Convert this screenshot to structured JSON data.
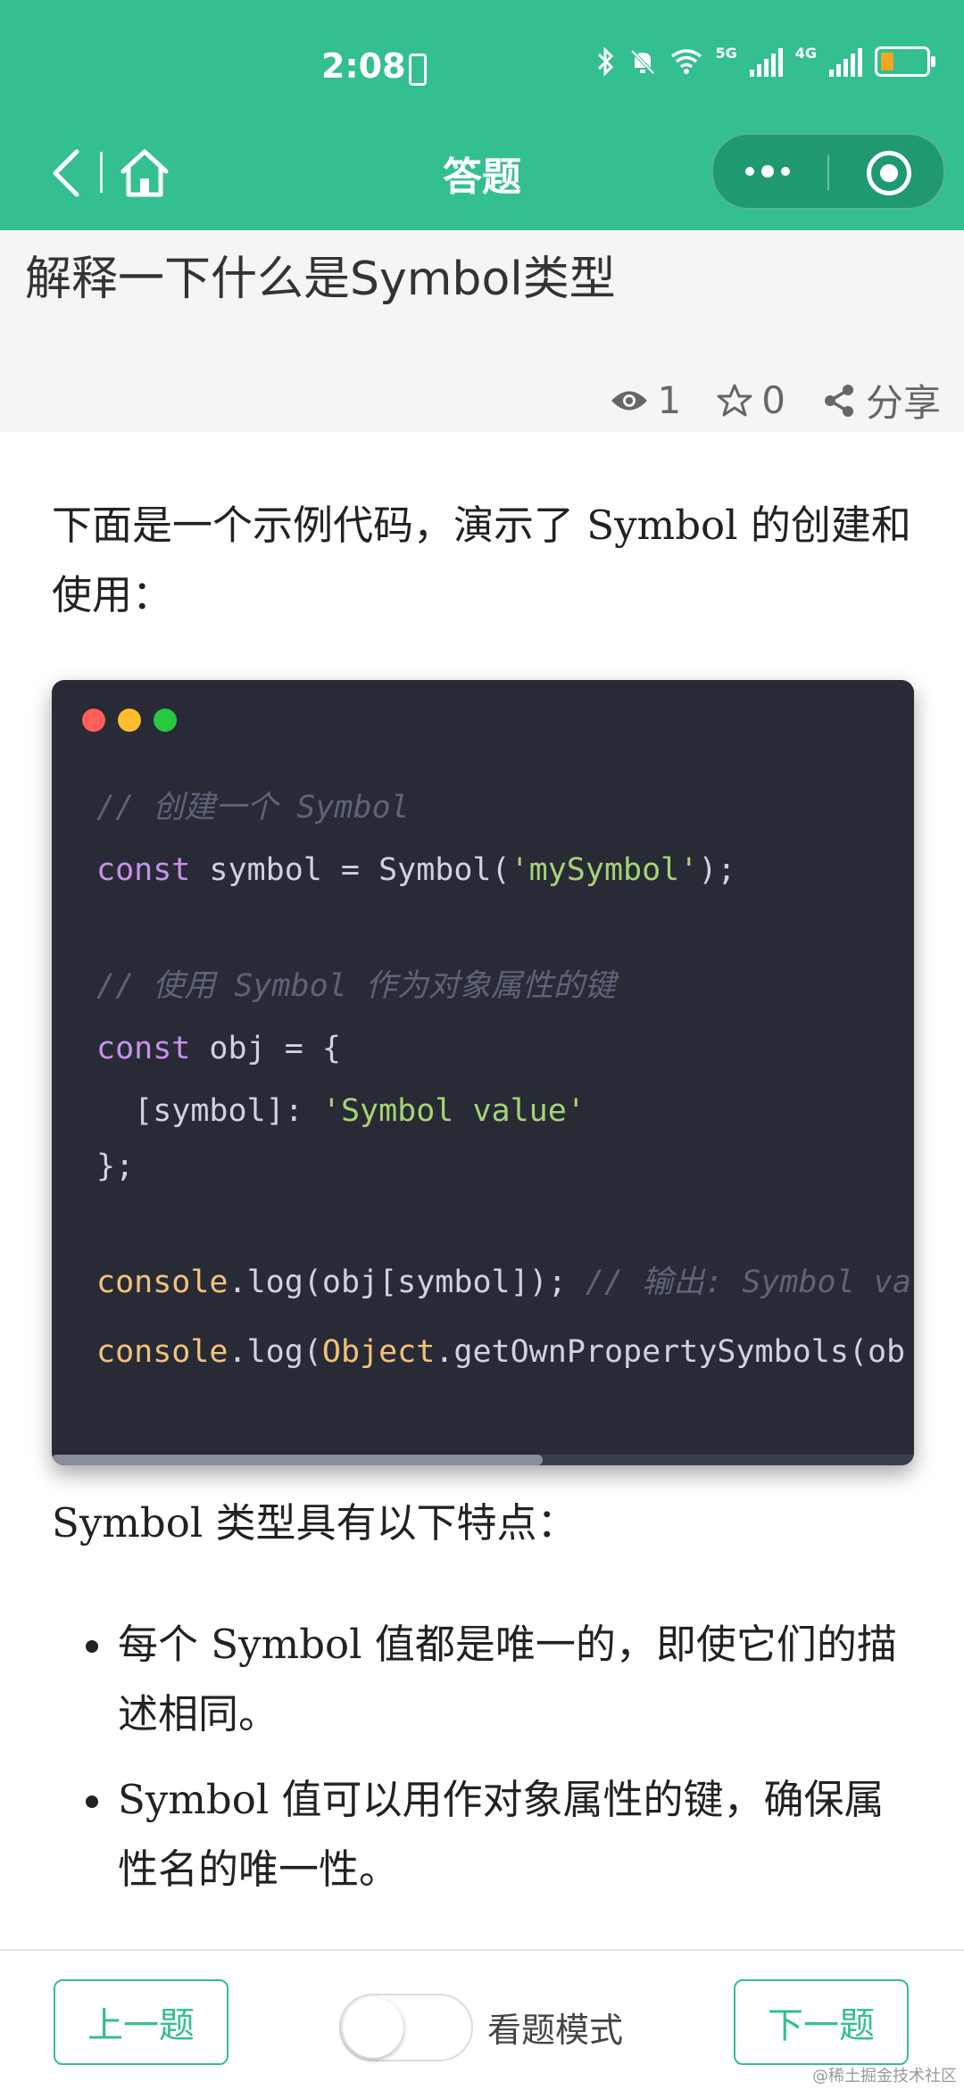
{
  "status_bar": {
    "time": "2:08",
    "net_small": "5G",
    "net_4g": "4G"
  },
  "nav": {
    "title": "答题"
  },
  "question": {
    "title": "解释一下什么是Symbol类型",
    "views": "1",
    "stars": "0",
    "share_label": "分享"
  },
  "content": {
    "intro": "下面是一个示例代码，演示了 Symbol 的创建和使用：",
    "code_lines": [
      {
        "comment": "// 创建一个 Symbol"
      },
      {
        "kw": "const",
        "pre": " symbol = Symbol(",
        "str": "'mySymbol'",
        "post": ");"
      },
      {
        "comment": "// 使用 Symbol 作为对象属性的键"
      },
      {
        "kw": "const",
        "pre": " obj = {"
      },
      {
        "pre": "  [symbol]: ",
        "str": "'Symbol value'"
      },
      {
        "pre": "};"
      },
      {
        "fn": "console",
        "pre": ".log(obj[symbol]); ",
        "comment": "// 输出: Symbol va"
      },
      {
        "fn": "console",
        "pre": ".log(",
        "fn2": "Object",
        "post": ".getOwnPropertySymbols(ob"
      }
    ],
    "features_heading": "Symbol 类型具有以下特点：",
    "bullets": [
      "每个 Symbol 值都是唯一的，即使它们的描述相同。",
      "Symbol 值可以用作对象属性的键，确保属性名的唯一性。"
    ]
  },
  "bottom": {
    "prev_label": "上一题",
    "next_label": "下一题",
    "mode_label": "看题模式",
    "watermark": "@稀土掘金技术社区"
  },
  "colors": {
    "brand": "#34bf8f",
    "code_bg": "#282a36"
  }
}
